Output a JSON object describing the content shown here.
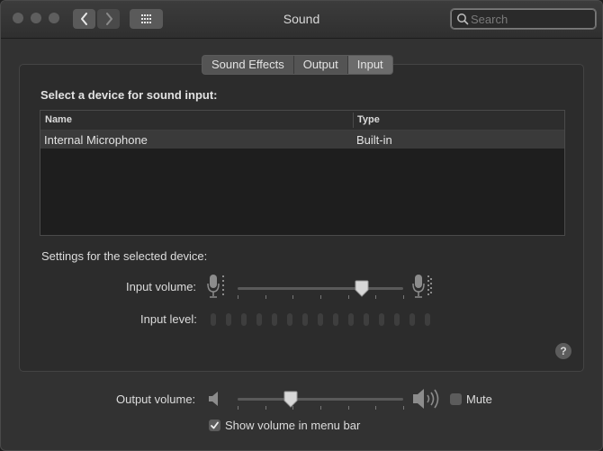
{
  "window": {
    "title": "Sound"
  },
  "toolbar": {
    "search_placeholder": "Search",
    "back_icon": "chevron-left-icon",
    "forward_icon": "chevron-right-icon",
    "show_all_icon": "grid-icon"
  },
  "tabs": [
    {
      "label": "Sound Effects",
      "selected": false
    },
    {
      "label": "Output",
      "selected": false
    },
    {
      "label": "Input",
      "selected": true
    }
  ],
  "input": {
    "heading": "Select a device for sound input:",
    "columns": [
      "Name",
      "Type"
    ],
    "devices": [
      {
        "name": "Internal Microphone",
        "type": "Built-in",
        "selected": true
      }
    ],
    "settings_heading": "Settings for the selected device:",
    "input_volume_label": "Input volume:",
    "input_volume_level": 0.75,
    "input_level_label": "Input level:",
    "input_level_segments": 15,
    "input_level_active": 0
  },
  "output": {
    "volume_label": "Output volume:",
    "volume_level": 0.32,
    "mute_label": "Mute",
    "mute_checked": false,
    "show_in_menu_bar_label": "Show volume in menu bar",
    "show_in_menu_bar_checked": true
  },
  "help": {
    "label": "?"
  },
  "colors": {
    "window_bg": "#323232",
    "selected_row": "#3a3a3a",
    "selected_tab": "#6c6c6c"
  }
}
